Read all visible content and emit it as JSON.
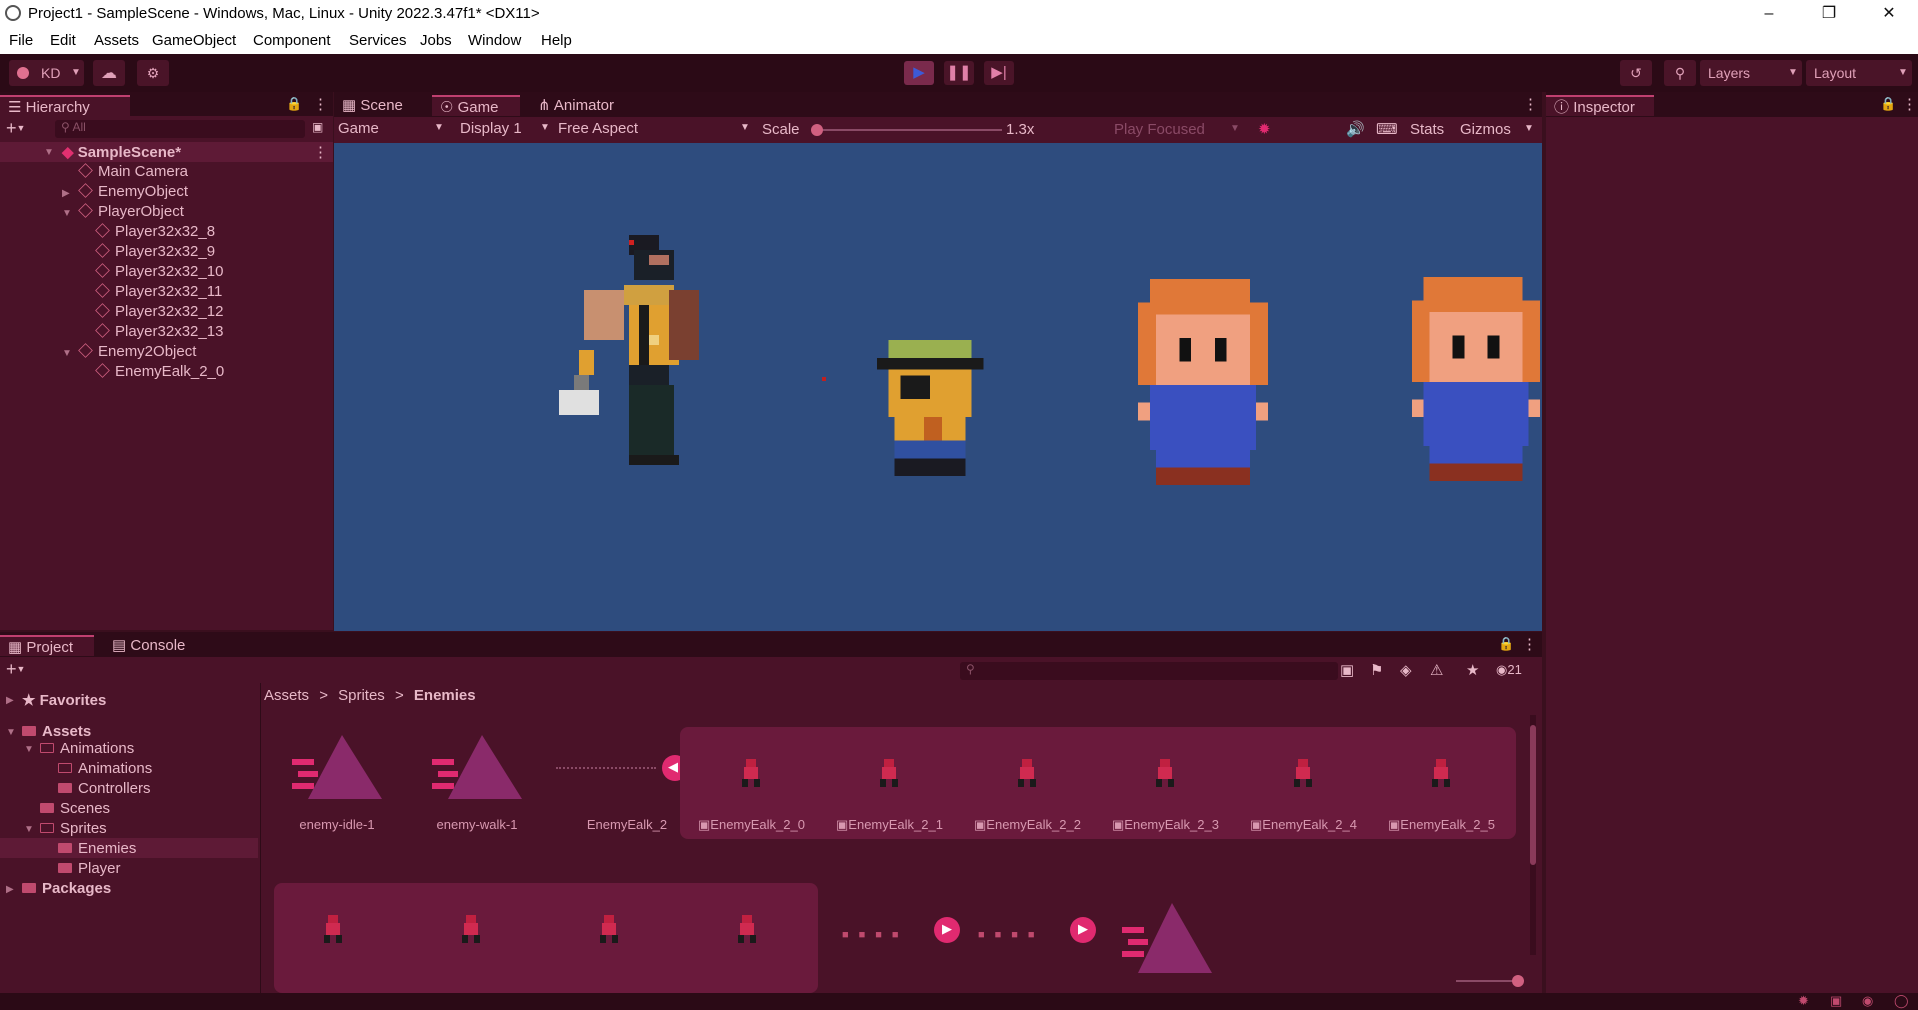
{
  "window": {
    "title": "Project1 - SampleScene - Windows, Mac, Linux - Unity 2022.3.47f1* <DX11>"
  },
  "menu": [
    "File",
    "Edit",
    "Assets",
    "GameObject",
    "Component",
    "Services",
    "Jobs",
    "Window",
    "Help"
  ],
  "toolbar": {
    "account": "KD",
    "layers": "Layers",
    "layout": "Layout"
  },
  "hierarchy": {
    "tab": "Hierarchy",
    "search_placeholder": "All",
    "items": [
      {
        "label": "SampleScene*"
      },
      {
        "label": "Main Camera"
      },
      {
        "label": "EnemyObject"
      },
      {
        "label": "PlayerObject"
      },
      {
        "label": "Player32x32_8"
      },
      {
        "label": "Player32x32_9"
      },
      {
        "label": "Player32x32_10"
      },
      {
        "label": "Player32x32_11"
      },
      {
        "label": "Player32x32_12"
      },
      {
        "label": "Player32x32_13"
      },
      {
        "label": "Enemy2Object"
      },
      {
        "label": "EnemyEalk_2_0"
      }
    ]
  },
  "view_tabs": {
    "scene": "Scene",
    "game": "Game",
    "animator": "Animator"
  },
  "game_toolbar": {
    "mode": "Game",
    "display": "Display 1",
    "aspect": "Free Aspect",
    "scale_label": "Scale",
    "scale_value": "1.3x",
    "play_focused": "Play Focused",
    "stats": "Stats",
    "gizmos": "Gizmos"
  },
  "inspector": {
    "tab": "Inspector"
  },
  "project": {
    "tab_project": "Project",
    "tab_console": "Console",
    "hidden_count": "21",
    "breadcrumb": [
      "Assets",
      "Sprites",
      "Enemies"
    ],
    "tree": {
      "favorites": "Favorites",
      "assets": "Assets",
      "animations": "Animations",
      "animations_sub": "Animations",
      "controllers": "Controllers",
      "scenes": "Scenes",
      "sprites": "Sprites",
      "enemies": "Enemies",
      "player": "Player",
      "packages": "Packages"
    },
    "grid_labels": [
      "enemy-idle-1",
      "enemy-walk-1",
      "EnemyEalk_2",
      "EnemyEalk_2_0",
      "EnemyEalk_2_1",
      "EnemyEalk_2_2",
      "EnemyEalk_2_3",
      "EnemyEalk_2_4",
      "EnemyEalk_2_5"
    ]
  },
  "colors": {
    "accent": "#e02a70",
    "panel": "#4a1228",
    "toolbar": "#2b0a16",
    "game_bg": "#2e4c7e"
  }
}
